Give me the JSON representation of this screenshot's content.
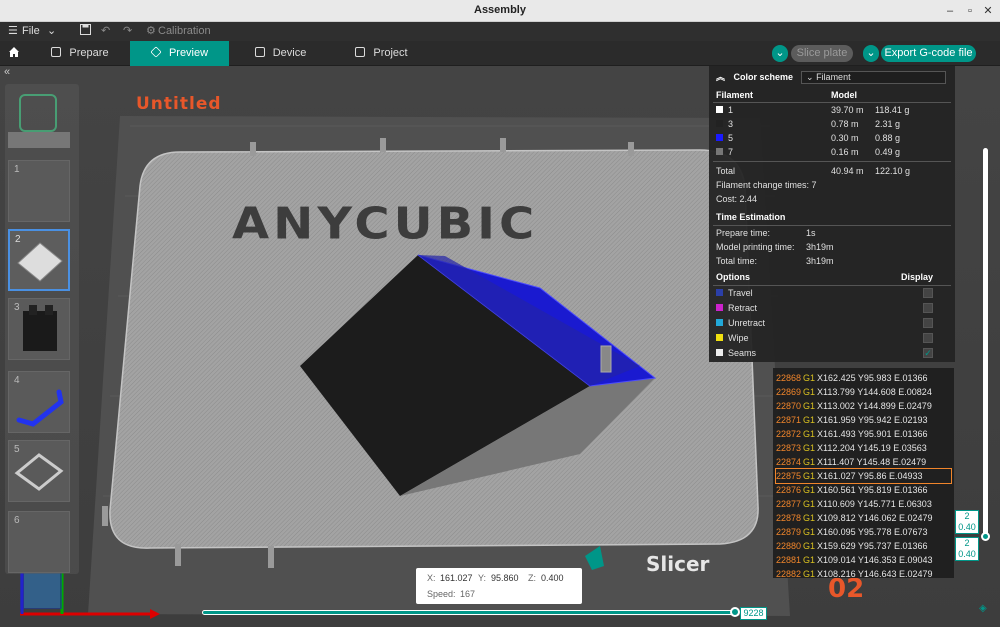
{
  "window": {
    "title": "Assembly"
  },
  "menubar": {
    "file": "File",
    "calibration": "Calibration"
  },
  "tabs": [
    {
      "label": "Prepare",
      "active": false
    },
    {
      "label": "Preview",
      "active": true
    },
    {
      "label": "Device",
      "active": false
    },
    {
      "label": "Project",
      "active": false
    }
  ],
  "actions": {
    "slice": "Slice plate",
    "export": "Export G-code file"
  },
  "scene": {
    "project_name": "Untitled",
    "logo_text": "ANYCUBIC",
    "slicer_text": "Slicer",
    "plate_number": "02"
  },
  "thumbs": [
    {
      "num": "1"
    },
    {
      "num": "2"
    },
    {
      "num": "3"
    },
    {
      "num": "4"
    },
    {
      "num": "5"
    },
    {
      "num": "6"
    }
  ],
  "panel": {
    "color_scheme_label": "Color scheme",
    "color_scheme_value": "Filament",
    "col_filament": "Filament",
    "col_model": "Model",
    "filaments": [
      {
        "id": "1",
        "length": "39.70 m",
        "weight": "118.41 g",
        "color": "#ffffff"
      },
      {
        "id": "3",
        "length": "0.78 m",
        "weight": "2.31 g",
        "color": "#222222"
      },
      {
        "id": "5",
        "length": "0.30 m",
        "weight": "0.88 g",
        "color": "#1a1aff"
      },
      {
        "id": "7",
        "length": "0.16 m",
        "weight": "0.49 g",
        "color": "#777777"
      }
    ],
    "total_label": "Total",
    "total_length": "40.94 m",
    "total_weight": "122.10 g",
    "change_times": "Filament change times:  7",
    "cost": "Cost:  2.44",
    "time_title": "Time Estimation",
    "prepare_label": "Prepare time:",
    "prepare_value": "1s",
    "model_label": "Model printing time:",
    "model_value": "3h19m",
    "total_time_label": "Total time:",
    "total_time_value": "3h19m",
    "options_label": "Options",
    "display_label": "Display",
    "options": [
      {
        "label": "Travel",
        "color": "#2b3fa8",
        "checked": false
      },
      {
        "label": "Retract",
        "color": "#cc22cc",
        "checked": false
      },
      {
        "label": "Unretract",
        "color": "#22a8d8",
        "checked": false
      },
      {
        "label": "Wipe",
        "color": "#f0e010",
        "checked": false
      },
      {
        "label": "Seams",
        "color": "#eeeeee",
        "checked": true
      }
    ]
  },
  "gcode": [
    {
      "n": "22868",
      "cmd": "G1",
      "args": "X162.425 Y95.983 E.01366"
    },
    {
      "n": "22869",
      "cmd": "G1",
      "args": "X113.799 Y144.608 E.00824"
    },
    {
      "n": "22870",
      "cmd": "G1",
      "args": "X113.002 Y144.899 E.02479"
    },
    {
      "n": "22871",
      "cmd": "G1",
      "args": "X161.959 Y95.942 E.02193"
    },
    {
      "n": "22872",
      "cmd": "G1",
      "args": "X161.493 Y95.901 E.01366"
    },
    {
      "n": "22873",
      "cmd": "G1",
      "args": "X112.204 Y145.19 E.03563"
    },
    {
      "n": "22874",
      "cmd": "G1",
      "args": "X111.407 Y145.48 E.02479"
    },
    {
      "n": "22875",
      "cmd": "G1",
      "args": "X161.027 Y95.86 E.04933",
      "current": true
    },
    {
      "n": "22876",
      "cmd": "G1",
      "args": "X160.561 Y95.819 E.01366"
    },
    {
      "n": "22877",
      "cmd": "G1",
      "args": "X110.609 Y145.771 E.06303"
    },
    {
      "n": "22878",
      "cmd": "G1",
      "args": "X109.812 Y146.062 E.02479"
    },
    {
      "n": "22879",
      "cmd": "G1",
      "args": "X160.095 Y95.778 E.07673"
    },
    {
      "n": "22880",
      "cmd": "G1",
      "args": "X159.629 Y95.737 E.01366"
    },
    {
      "n": "22881",
      "cmd": "G1",
      "args": "X109.014 Y146.353 E.09043"
    },
    {
      "n": "22882",
      "cmd": "G1",
      "args": "X108.216 Y146.643 E.02479"
    }
  ],
  "position": {
    "x_label": "X:",
    "x": "161.027",
    "y_label": "Y:",
    "y": "95.860",
    "z_label": "Z:",
    "z": "0.400",
    "speed_label": "Speed:",
    "speed": "167"
  },
  "sliders": {
    "moves": "9228",
    "layer_top_num": "2",
    "layer_top_z": "0.40",
    "layer_bot_num": "2",
    "layer_bot_z": "0.40"
  }
}
